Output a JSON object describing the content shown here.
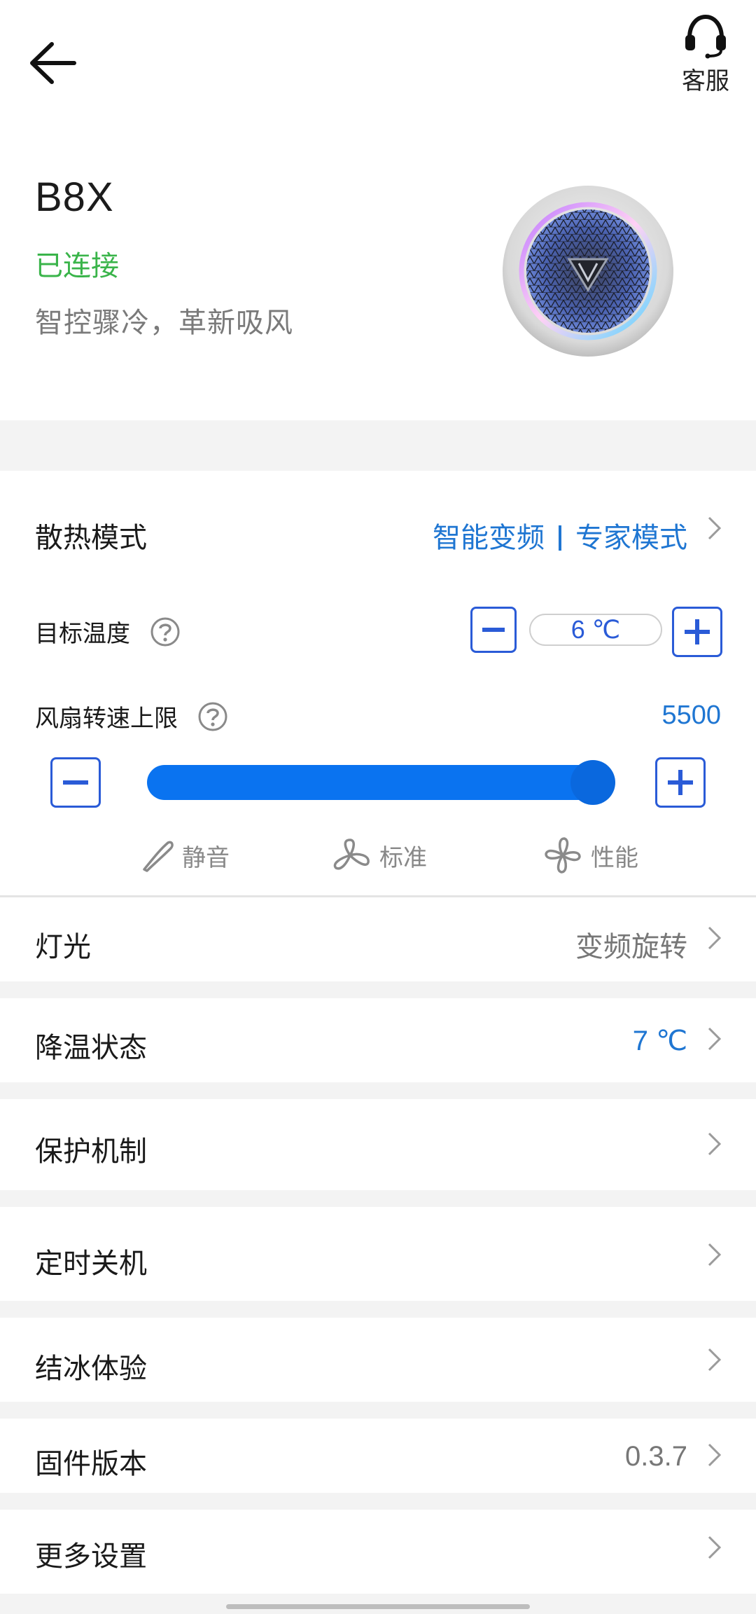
{
  "header": {
    "back_icon": "arrow-left-icon",
    "support_icon": "headset-icon",
    "support_label": "客服"
  },
  "device": {
    "name": "B8X",
    "status": "已连接",
    "slogan": "智控骤冷，革新吸风",
    "status_color": "#3ab44a"
  },
  "cooling_mode": {
    "label": "散热模式",
    "value_a": "智能变频",
    "value_b": "专家模式",
    "accent": "#1f76d2"
  },
  "target_temp": {
    "label": "目标温度",
    "value": "6 ℃"
  },
  "fan_speed": {
    "label": "风扇转速上限",
    "value": "5500",
    "level": 1.0,
    "presets": [
      "静音",
      "标准",
      "性能"
    ]
  },
  "rows": [
    {
      "label": "灯光",
      "value": "变频旋转"
    },
    {
      "label": "降温状态",
      "value": "7 ℃"
    },
    {
      "label": "保护机制",
      "value": ""
    },
    {
      "label": "定时关机",
      "value": ""
    },
    {
      "label": "结冰体验",
      "value": ""
    },
    {
      "label": "固件版本",
      "value": "0.3.7"
    },
    {
      "label": "更多设置",
      "value": ""
    }
  ]
}
